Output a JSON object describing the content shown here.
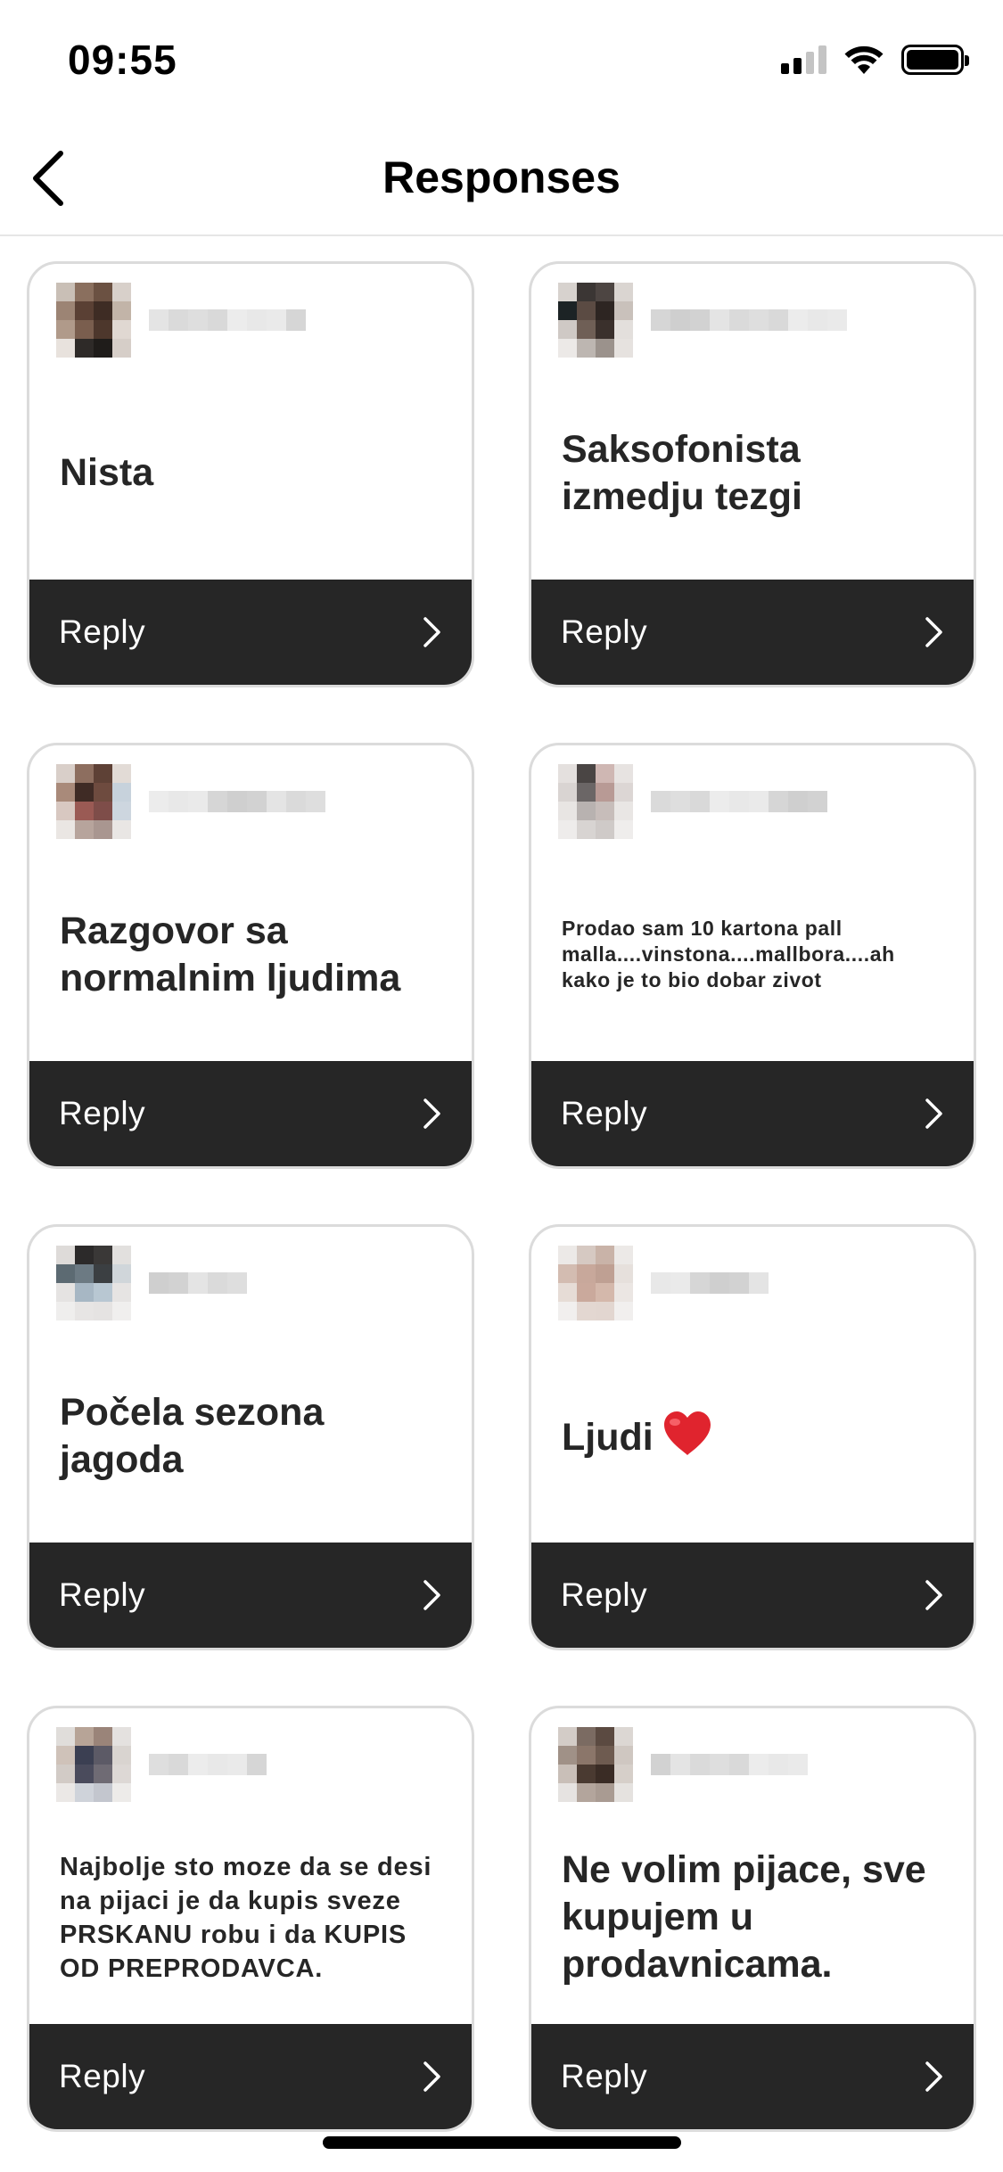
{
  "status_bar": {
    "time": "09:55"
  },
  "header": {
    "title": "Responses"
  },
  "responses": [
    {
      "text": "Nista",
      "size": "large",
      "reply_label": "Reply"
    },
    {
      "text": "Saksofonista izmedju tezgi",
      "size": "large",
      "reply_label": "Reply"
    },
    {
      "text": "Razgovor sa normalnim ljudima",
      "size": "large",
      "reply_label": "Reply"
    },
    {
      "text": "Prodao sam 10 kartona pall malla....vinstona....mallbora....ah kako je to bio dobar zivot",
      "size": "small",
      "reply_label": "Reply"
    },
    {
      "text": "Počela sezona jagoda",
      "size": "large",
      "reply_label": "Reply"
    },
    {
      "text": "Ljudi",
      "size": "large",
      "emoji": "heart-icon",
      "reply_label": "Reply"
    },
    {
      "text": "Najbolje sto moze da se desi na pijaci je da kupis sveze PRSKANU robu i da KUPIS OD PREPRODAVCA.",
      "size": "medium",
      "reply_label": "Reply"
    },
    {
      "text": "Ne volim pijace, sve kupujem u prodavnicama.",
      "size": "large",
      "reply_label": "Reply"
    }
  ],
  "colors": {
    "reply_bar": "#262626",
    "card_border": "#dbdbdb",
    "heart": "#e0242e"
  }
}
